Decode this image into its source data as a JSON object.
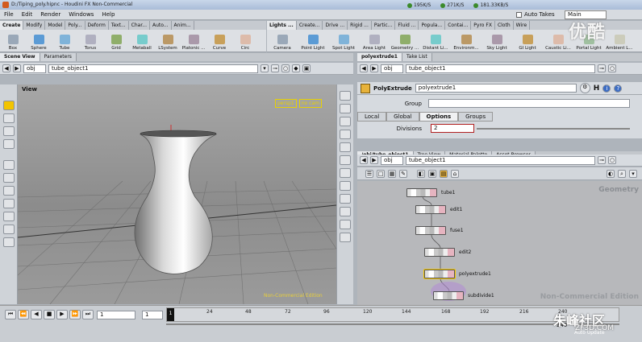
{
  "window": {
    "title": "D:/Tiping_poly.hipnc - Houdini FX Non-Commercial"
  },
  "netmeter": {
    "down": "195K/S",
    "up": "271K/S",
    "total": "181.33KB/S"
  },
  "menu": [
    "File",
    "Edit",
    "Render",
    "Windows",
    "Help"
  ],
  "autotakes": "Auto Takes",
  "desktop_select": "Main",
  "shelf_left": {
    "tabs": [
      "Create",
      "Modify",
      "Model",
      "Poly...",
      "Deform",
      "Text...",
      "Char...",
      "Auto...",
      "Anim..."
    ],
    "tools": [
      "Box",
      "Sphere",
      "Tube",
      "Torus",
      "Grid",
      "Metaball",
      "LSystem",
      "Platonic ...",
      "Curve",
      "Circ"
    ]
  },
  "shelf_right": {
    "tabs": [
      "Lights ...",
      "Create...",
      "Drive ...",
      "Rigid ...",
      "Partic...",
      "Fluid ...",
      "Popula...",
      "Contai...",
      "Pyro FX",
      "Cloth",
      "Wire"
    ],
    "tools": [
      "Camera",
      "Point Light",
      "Spot Light",
      "Area Light",
      "Geometry ...",
      "Distant Li...",
      "Environm...",
      "Sky Light",
      "GI Light",
      "Caustic Li...",
      "Portal Light",
      "Ambient L..."
    ]
  },
  "left_pane": {
    "tabs": [
      "Scene View",
      "Parameters"
    ],
    "path_root": "obj",
    "path_node": "tube_object1",
    "view_label": "View",
    "camera": {
      "persp": "persp1",
      "cam": "no cam"
    },
    "watermark": "Non-Commercial Edition"
  },
  "param_pane": {
    "tabs": [
      "polyextrude1",
      "Take List"
    ],
    "path_root": "obj",
    "path_node": "tube_object1",
    "node_type": "PolyExtrude",
    "node_name": "polyextrude1",
    "group_label": "Group",
    "group_value": "",
    "subtabs": [
      "Local",
      "Global",
      "Options",
      "Groups"
    ],
    "active_subtab": "Options",
    "divisions_label": "Divisions",
    "divisions_value": "2"
  },
  "net_pane": {
    "tabs": [
      "/obj/tube_object1",
      "Tree View",
      "Material Palette",
      "Asset Browser"
    ],
    "path_root": "obj",
    "path_node": "tube_object1",
    "context": "Geometry",
    "watermark": "Non-Commercial Edition",
    "nodes": [
      "tube1",
      "edit1",
      "fuse1",
      "edit2",
      "polyextrude1",
      "subdivide1"
    ]
  },
  "timeline": {
    "frame": "1",
    "start": "1",
    "end_field": "1",
    "ticks": [
      "1",
      "24",
      "48",
      "72",
      "96",
      "120",
      "144",
      "168",
      "192",
      "216",
      "240"
    ],
    "end_frame": "240",
    "auto_update": "Auto Update"
  },
  "overlay": {
    "logo": "优酷",
    "site": "朱峰社区",
    "site_url": "ZF3D.COM"
  },
  "colors": {
    "accent": "#3b6cc4",
    "node_select": "#f2c400"
  }
}
